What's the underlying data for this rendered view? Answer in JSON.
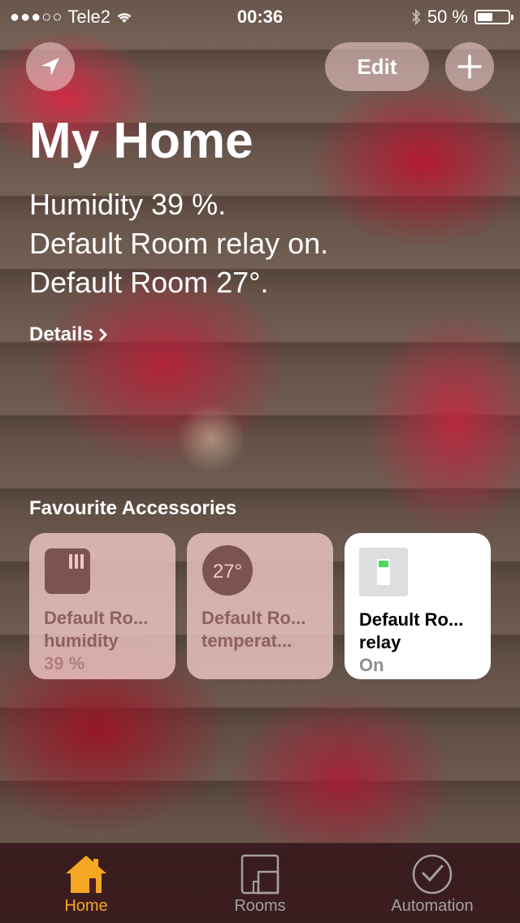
{
  "status_bar": {
    "signal_dots": "●●●○○",
    "carrier": "Tele2",
    "wifi_icon": "wifi-icon",
    "time": "00:36",
    "bluetooth_icon": "bluetooth-icon",
    "battery_text": "50 %",
    "battery_level": 0.5
  },
  "toolbar": {
    "location_icon": "location-arrow-icon",
    "edit_label": "Edit",
    "add_icon": "plus-icon"
  },
  "home": {
    "title": "My Home",
    "summary_lines": [
      "Humidity 39 %.",
      "Default Room relay on.",
      "Default Room 27°."
    ],
    "details_label": "Details",
    "favourites_title": "Favourite Accessories"
  },
  "accessories": [
    {
      "icon": "humidity-sensor-icon",
      "name_line1": "Default Ro...",
      "name_line2": "humidity",
      "state": "39 %",
      "on": false
    },
    {
      "icon": "temperature-icon",
      "icon_text": "27°",
      "name_line1": "Default Ro...",
      "name_line2": "temperat...",
      "state": "",
      "on": false
    },
    {
      "icon": "switch-icon",
      "name_line1": "Default Ro...",
      "name_line2": "relay",
      "state": "On",
      "on": true
    }
  ],
  "tabs": [
    {
      "label": "Home",
      "icon": "house-icon",
      "active": true
    },
    {
      "label": "Rooms",
      "icon": "rooms-icon",
      "active": false
    },
    {
      "label": "Automation",
      "icon": "clock-icon",
      "active": false
    }
  ],
  "colors": {
    "accent": "#f5a623",
    "tile_on": "#ffffff",
    "tile_off": "#f0c8c8",
    "tab_inactive": "#a3a0a0"
  }
}
